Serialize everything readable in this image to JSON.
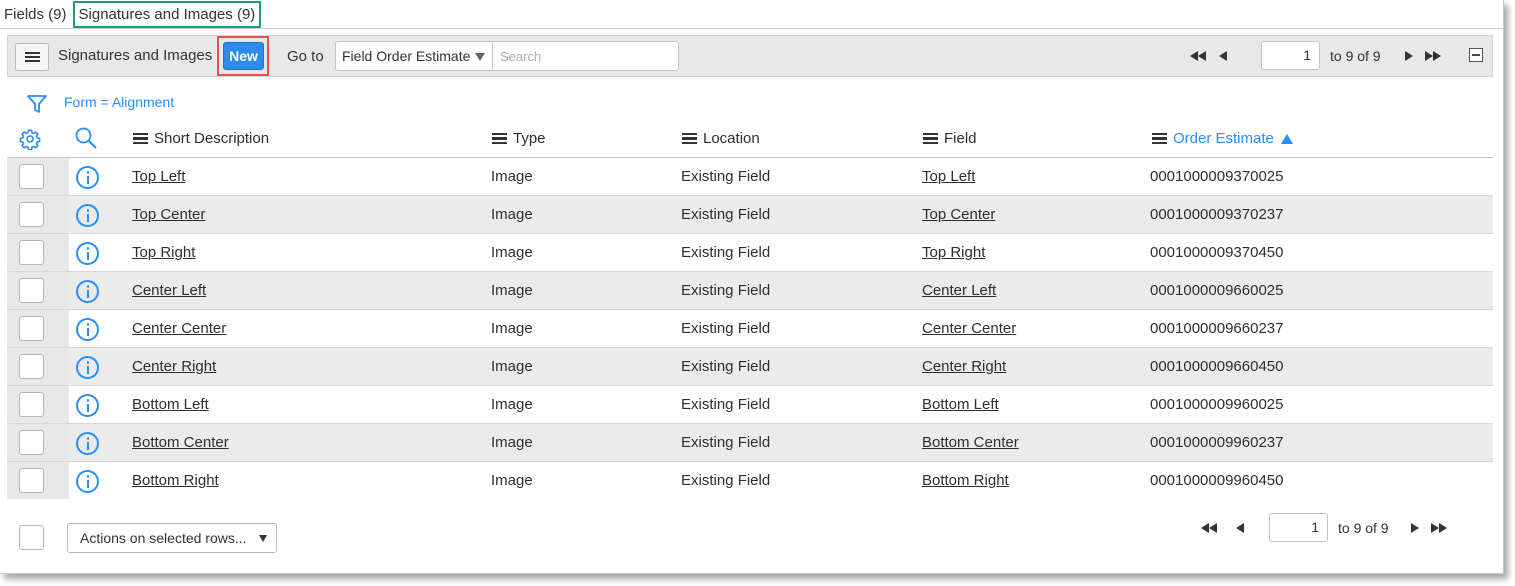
{
  "tabs": [
    {
      "label": "Fields (9)",
      "active": false
    },
    {
      "label": "Signatures and Images (9)",
      "active": true
    }
  ],
  "toolbar": {
    "title": "Signatures and Images",
    "new_label": "New",
    "goto_label": "Go to",
    "goto_field": "Field Order Estimate",
    "search_placeholder": "Search"
  },
  "pager_top": {
    "current": "1",
    "range_text": "to 9 of 9"
  },
  "pager_bottom": {
    "current": "1",
    "range_text": "to 9 of 9"
  },
  "filter": {
    "text": "Form = Alignment"
  },
  "columns": [
    {
      "label": "Short Description",
      "sorted": false
    },
    {
      "label": "Type",
      "sorted": false
    },
    {
      "label": "Location",
      "sorted": false
    },
    {
      "label": "Field",
      "sorted": false
    },
    {
      "label": "Order Estimate",
      "sorted": true,
      "direction": "ascending"
    }
  ],
  "rows": [
    {
      "short_description": "Top Left",
      "type": "Image",
      "location": "Existing Field",
      "field": "Top Left",
      "order_estimate": "0001000009370025"
    },
    {
      "short_description": "Top Center",
      "type": "Image",
      "location": "Existing Field",
      "field": "Top Center",
      "order_estimate": "0001000009370237"
    },
    {
      "short_description": "Top Right",
      "type": "Image",
      "location": "Existing Field",
      "field": "Top Right",
      "order_estimate": "0001000009370450"
    },
    {
      "short_description": "Center Left",
      "type": "Image",
      "location": "Existing Field",
      "field": "Center Left",
      "order_estimate": "0001000009660025"
    },
    {
      "short_description": "Center Center",
      "type": "Image",
      "location": "Existing Field",
      "field": "Center Center",
      "order_estimate": "0001000009660237"
    },
    {
      "short_description": "Center Right",
      "type": "Image",
      "location": "Existing Field",
      "field": "Center Right",
      "order_estimate": "0001000009660450"
    },
    {
      "short_description": "Bottom Left",
      "type": "Image",
      "location": "Existing Field",
      "field": "Bottom Left",
      "order_estimate": "0001000009960025"
    },
    {
      "short_description": "Bottom Center",
      "type": "Image",
      "location": "Existing Field",
      "field": "Bottom Center",
      "order_estimate": "0001000009960237"
    },
    {
      "short_description": "Bottom Right",
      "type": "Image",
      "location": "Existing Field",
      "field": "Bottom Right",
      "order_estimate": "0001000009960450"
    }
  ],
  "footer": {
    "actions_label": "Actions on selected rows..."
  },
  "colors": {
    "accent": "#278efc",
    "new_button": "#2d8ceb",
    "highlight_red": "#e2524c",
    "highlight_green": "#1d9c77"
  },
  "icons": [
    "hamburger-icon",
    "filter-icon",
    "gear-icon",
    "search-icon",
    "info-icon",
    "first-page-icon",
    "previous-page-icon",
    "next-page-icon",
    "last-page-icon",
    "collapse-icon",
    "sort-ascending-icon"
  ]
}
